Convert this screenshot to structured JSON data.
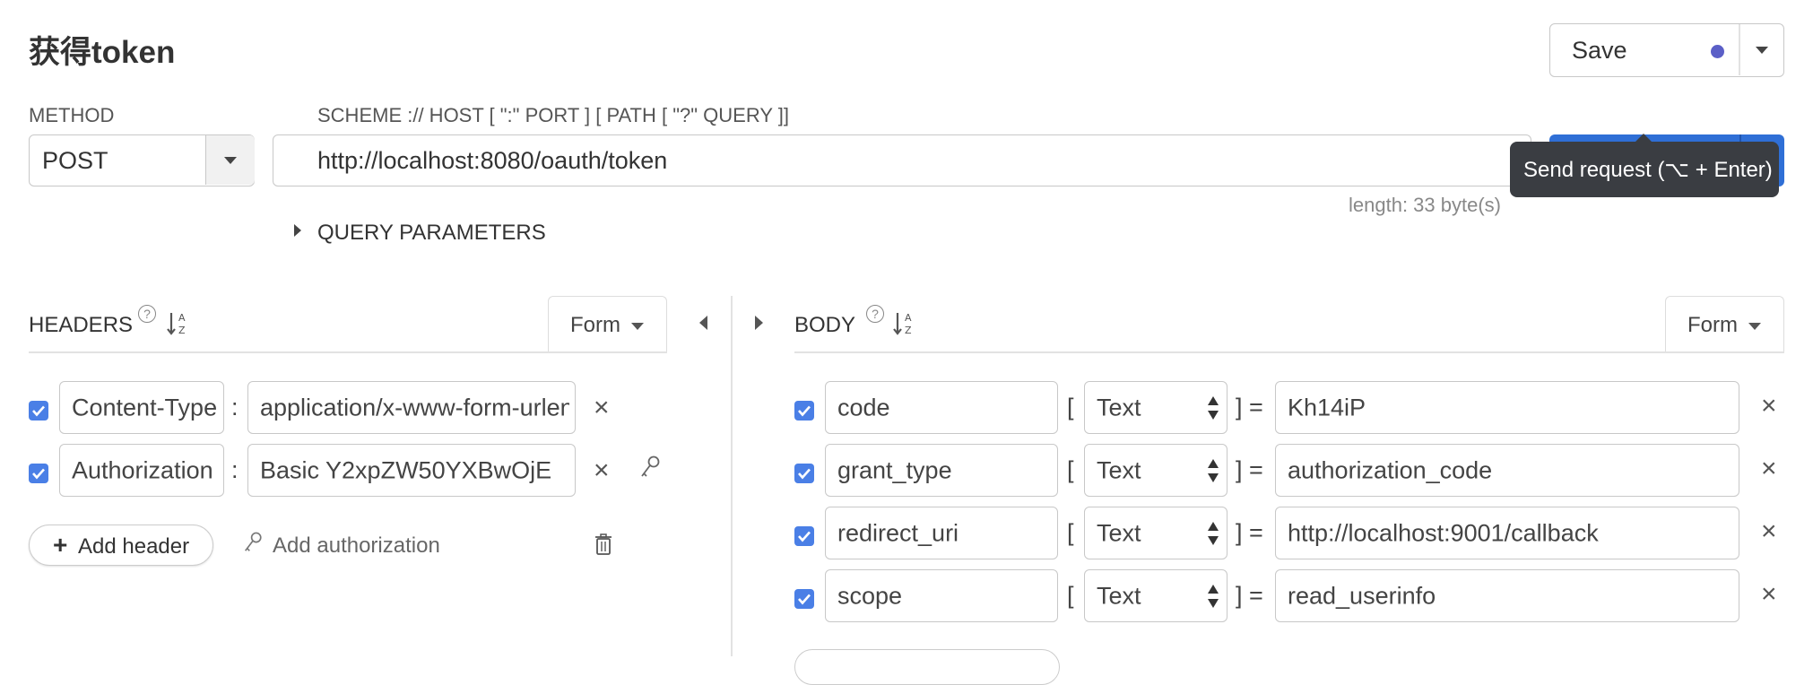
{
  "request": {
    "title": "获得token",
    "save_label": "Save",
    "method_label": "METHOD",
    "method_value": "POST",
    "url_label": "SCHEME :// HOST [ \":\" PORT ] [ PATH [ \"?\" QUERY ]]",
    "url_value": "http://localhost:8080/oauth/token",
    "length_text": "length: 33 byte(s)",
    "send_tooltip": "Send request (⌥ + Enter)",
    "query_params_label": "QUERY PARAMETERS"
  },
  "headers": {
    "title": "HEADERS",
    "format_label": "Form",
    "add_header_label": "Add header",
    "add_auth_label": "Add authorization",
    "items": [
      {
        "name": "Content-Type",
        "value": "application/x-www-form-urlencoded"
      },
      {
        "name": "Authorization",
        "value": "Basic Y2xpZW50YXBwOjE"
      }
    ]
  },
  "body": {
    "title": "BODY",
    "format_label": "Form",
    "items": [
      {
        "name": "code",
        "type": "Text",
        "value": "Kh14iP"
      },
      {
        "name": "grant_type",
        "type": "Text",
        "value": "authorization_code"
      },
      {
        "name": "redirect_uri",
        "type": "Text",
        "value": "http://localhost:9001/callback"
      },
      {
        "name": "scope",
        "type": "Text",
        "value": "read_userinfo"
      }
    ]
  },
  "colors": {
    "accent": "#2f6fd6",
    "checkbox": "#4a7fe6",
    "save_dot": "#5b5fc7",
    "tooltip_bg": "#3a3d42"
  }
}
